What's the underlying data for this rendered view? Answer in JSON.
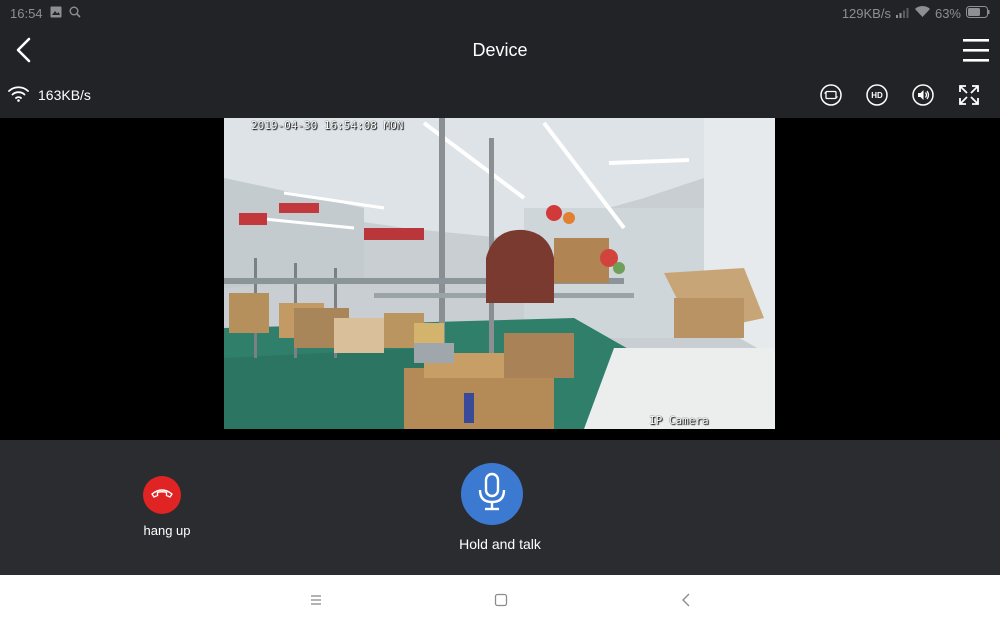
{
  "status_bar": {
    "time": "16:54",
    "net_speed": "129KB/s",
    "battery": "63%",
    "icons": [
      "image-icon",
      "search-icon",
      "signal-icon",
      "wifi-icon",
      "battery-icon"
    ]
  },
  "header": {
    "title": "Device",
    "icons": [
      "back-arrow-icon",
      "hamburger-menu-icon"
    ]
  },
  "toolbar": {
    "speed": "163KB/s",
    "icons": [
      "wifi-icon",
      "screenshot-icon",
      "hd-icon",
      "volume-icon",
      "fullscreen-icon"
    ],
    "hd_label": "HD"
  },
  "video": {
    "timestamp": "2019-04-30 16:54:08 MON",
    "watermark": "IP Camera"
  },
  "controls": {
    "hangup_label": "hang up",
    "talk_label": "Hold and talk",
    "hangup_color": "#e02323",
    "talk_color": "#3c7ad2"
  },
  "nav_bar": {
    "icons": [
      "recents-menu-icon",
      "home-square-icon",
      "back-chevron-icon"
    ]
  }
}
